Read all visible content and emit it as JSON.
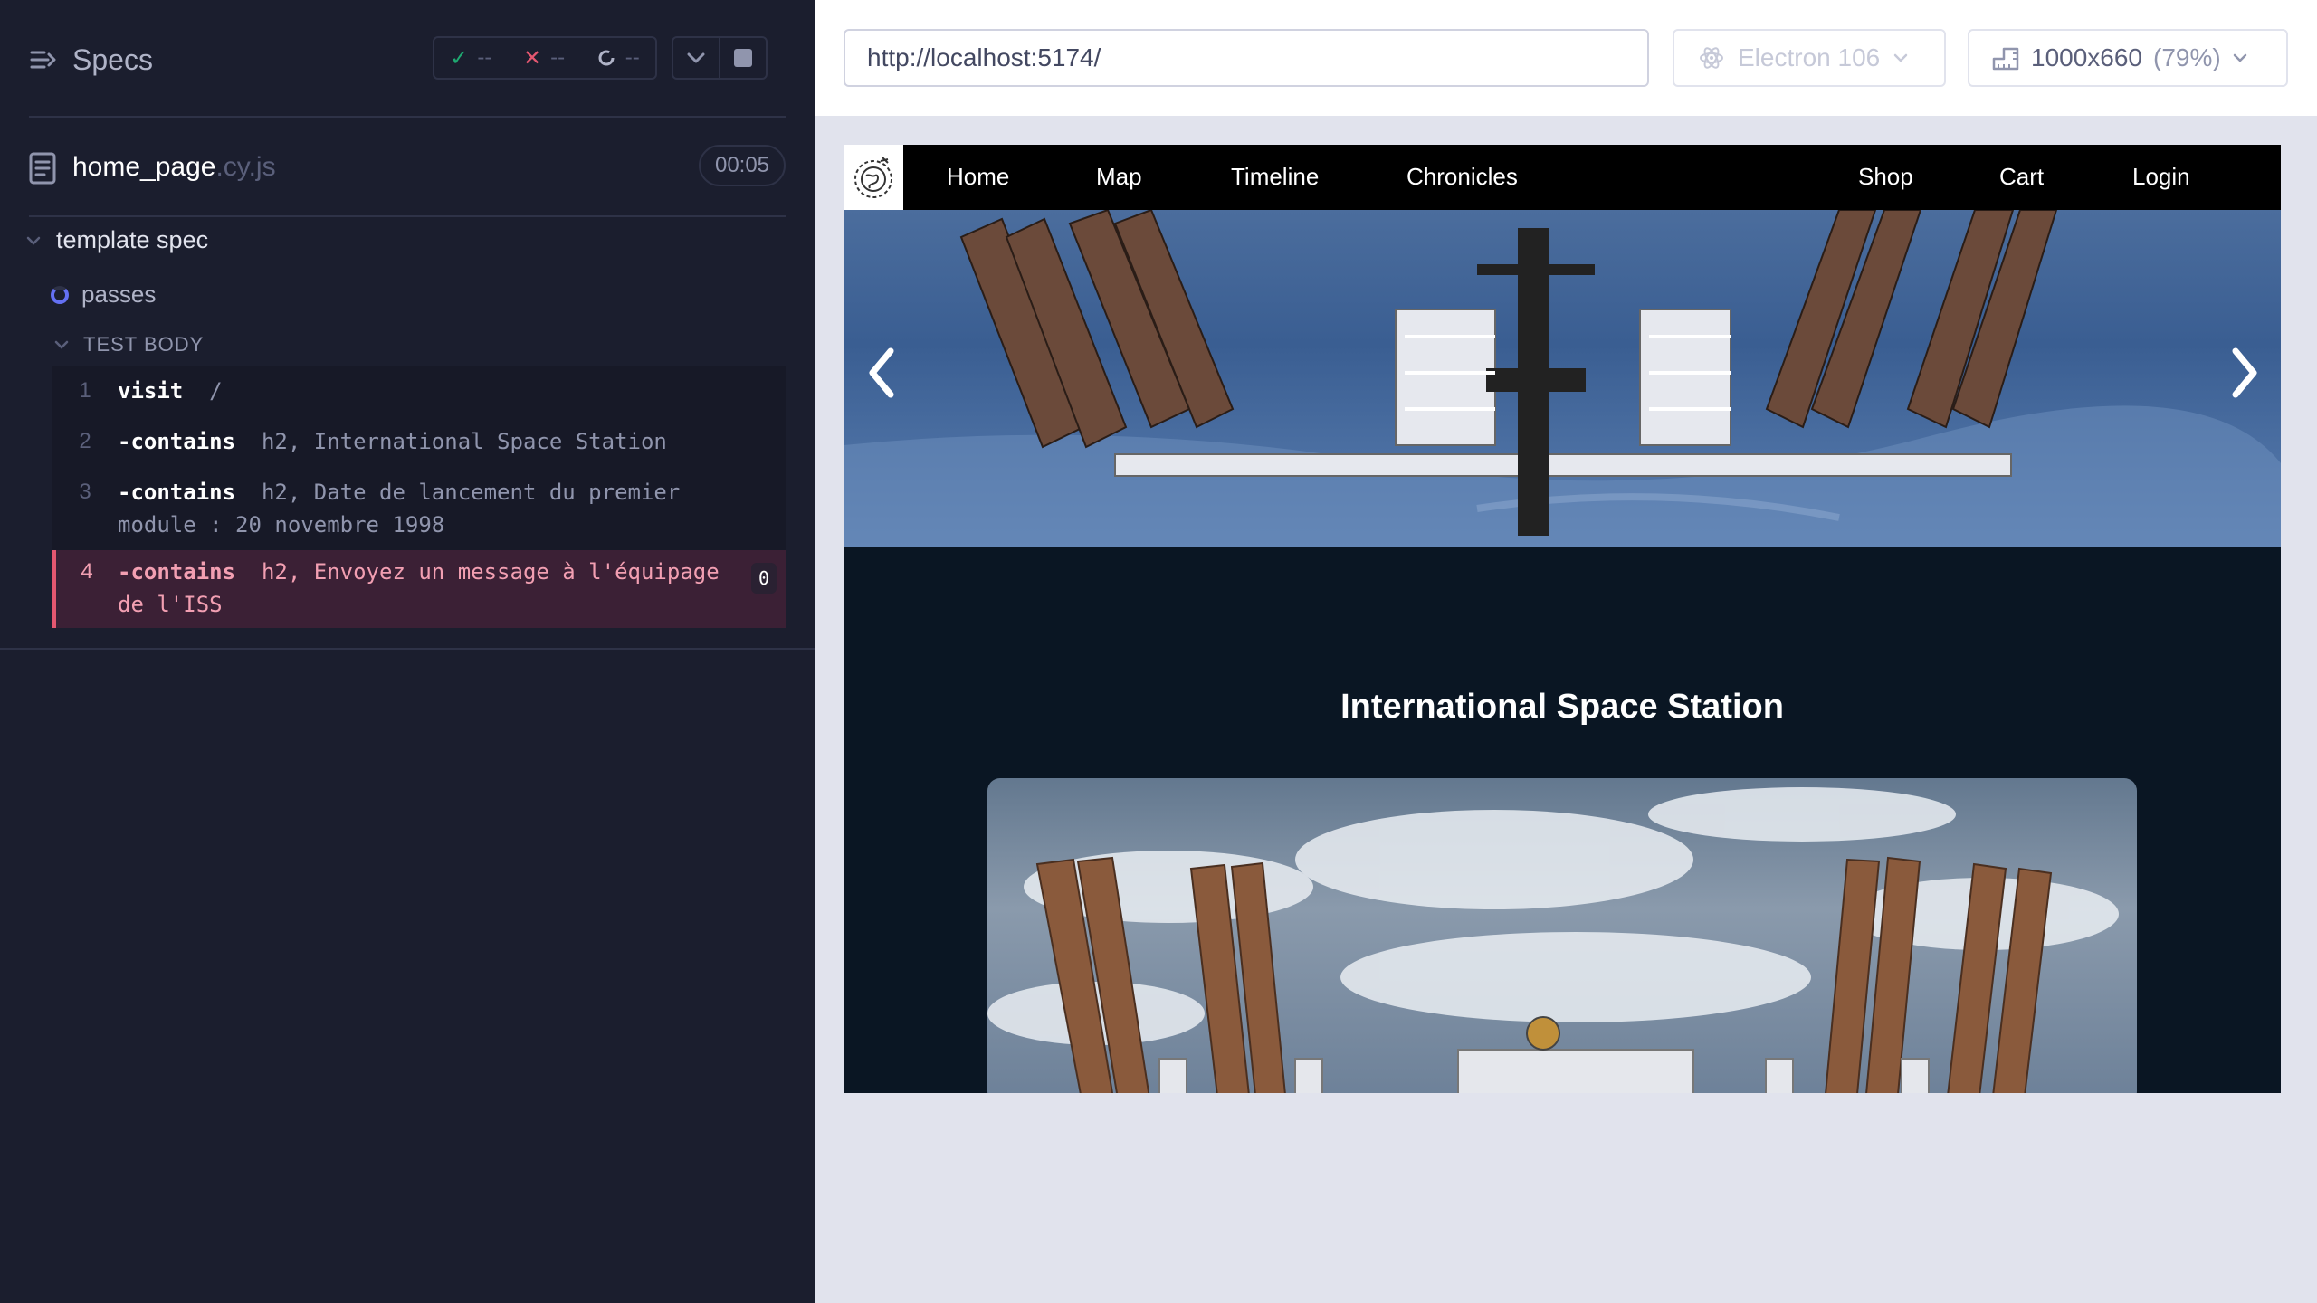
{
  "reporter": {
    "title": "Specs",
    "stats": {
      "passed": "--",
      "failed": "--",
      "pending": "--"
    },
    "file": {
      "name": "home_page",
      "ext": ".cy.js",
      "duration": "00:05"
    },
    "suite": "template spec",
    "test": "passes",
    "section": "TEST BODY",
    "commands": [
      {
        "num": "1",
        "prefix": "",
        "name": "visit",
        "arg": "/",
        "arg2": ""
      },
      {
        "num": "2",
        "prefix": "-",
        "name": "contains",
        "arg": "h2, International Space Station",
        "arg2": ""
      },
      {
        "num": "3",
        "prefix": "-",
        "name": "contains",
        "arg": "h2, Date de lancement du premier",
        "arg2": "module : 20 novembre 1998"
      },
      {
        "num": "4",
        "prefix": "-",
        "name": "contains",
        "arg": "h2, Envoyez un message à l'équipage",
        "arg2": "de l'ISS",
        "count": "0"
      }
    ]
  },
  "preview": {
    "url": "http://localhost:5174/",
    "browser": "Electron 106",
    "viewport": "1000x660",
    "zoom": "(79%)"
  },
  "site": {
    "nav": {
      "home": "Home",
      "map": "Map",
      "timeline": "Timeline",
      "chronicles": "Chronicles",
      "shop": "Shop",
      "cart": "Cart",
      "login": "Login"
    },
    "heading": "International Space Station"
  },
  "colors": {
    "pass": "#1fa971",
    "fail": "#e45770",
    "accent": "#6470f3"
  }
}
